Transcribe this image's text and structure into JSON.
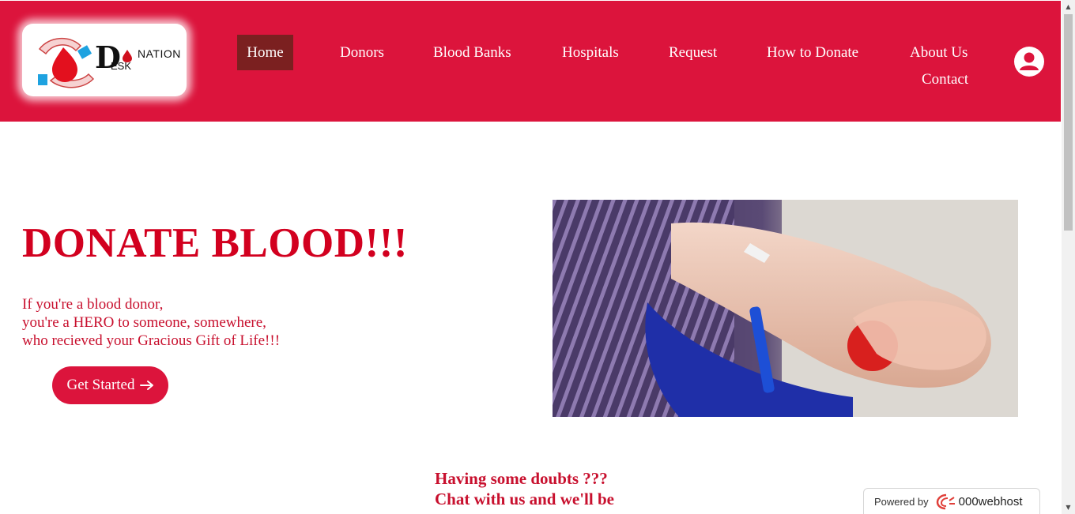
{
  "header": {
    "logo": {
      "text_d": "D",
      "text_nation": "NATION",
      "text_esk": "ESK"
    },
    "nav": {
      "home": "Home",
      "donors": "Donors",
      "blood_banks": "Blood Banks",
      "hospitals": "Hospitals",
      "request": "Request",
      "how_to_donate": "How to Donate",
      "about_us": "About Us",
      "contact": "Contact"
    },
    "avatar_icon": "user-icon"
  },
  "hero": {
    "title": "DONATE BLOOD!!!",
    "lines": [
      "If you're a blood donor,",
      "you're a HERO to someone, somewhere,",
      "who recieved your Gracious Gift of Life!!!"
    ],
    "button_label": "Get Started",
    "button_icon": "arrow-right-icon"
  },
  "chat": {
    "line1": "Having some doubts ???",
    "line2": "Chat with us and we'll be"
  },
  "badge": {
    "powered_by": "Powered by",
    "brand": "000webhost"
  },
  "colors": {
    "brand_red": "#dc143c",
    "active_nav": "#7b2020",
    "title_red": "#d2001f"
  }
}
